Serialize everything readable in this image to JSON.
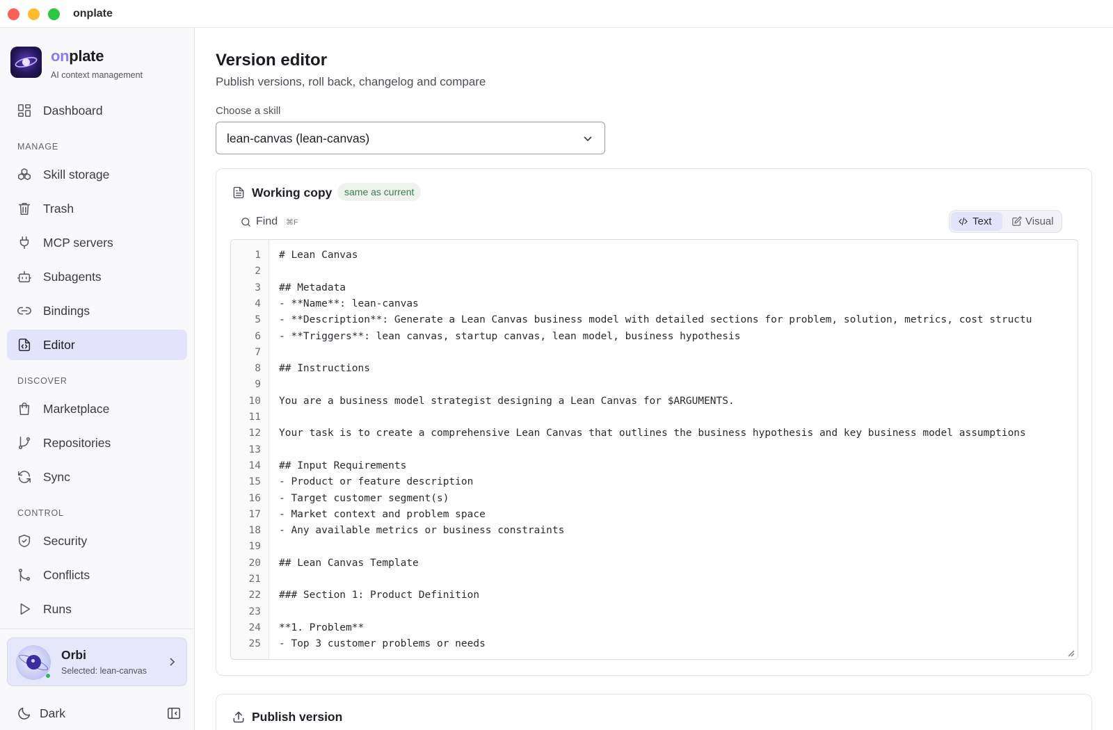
{
  "window": {
    "title": "onplate"
  },
  "brand": {
    "name_accent": "on",
    "name_rest": "plate",
    "subtitle": "AI context management"
  },
  "nav": {
    "dashboard": "Dashboard",
    "manage_label": "MANAGE",
    "skill_storage": "Skill storage",
    "trash": "Trash",
    "mcp_servers": "MCP servers",
    "subagents": "Subagents",
    "bindings": "Bindings",
    "editor": "Editor",
    "discover_label": "DISCOVER",
    "marketplace": "Marketplace",
    "repositories": "Repositories",
    "sync": "Sync",
    "control_label": "CONTROL",
    "security": "Security",
    "conflicts": "Conflicts",
    "runs": "Runs",
    "active_item": "Editor"
  },
  "assistant": {
    "name": "Orbi",
    "status": "Selected: lean-canvas"
  },
  "theme": {
    "label": "Dark"
  },
  "page": {
    "title": "Version editor",
    "subtitle": "Publish versions, roll back, changelog and compare",
    "choose_label": "Choose a skill",
    "selected_skill": "lean-canvas (lean-canvas)"
  },
  "working_copy": {
    "title": "Working copy",
    "badge": "same as current",
    "find_label": "Find",
    "find_shortcut": "⌘F",
    "mode_text": "Text",
    "mode_visual": "Visual",
    "active_mode": "Text"
  },
  "code_lines": [
    "# Lean Canvas",
    "",
    "## Metadata",
    "- **Name**: lean-canvas",
    "- **Description**: Generate a Lean Canvas business model with detailed sections for problem, solution, metrics, cost structu",
    "- **Triggers**: lean canvas, startup canvas, lean model, business hypothesis",
    "",
    "## Instructions",
    "",
    "You are a business model strategist designing a Lean Canvas for $ARGUMENTS.",
    "",
    "Your task is to create a comprehensive Lean Canvas that outlines the business hypothesis and key business model assumptions",
    "",
    "## Input Requirements",
    "- Product or feature description",
    "- Target customer segment(s)",
    "- Market context and problem space",
    "- Any available metrics or business constraints",
    "",
    "## Lean Canvas Template",
    "",
    "### Section 1: Product Definition",
    "",
    "**1. Problem**",
    "- Top 3 customer problems or needs"
  ],
  "publish": {
    "title": "Publish version"
  },
  "colors": {
    "accent": "#8a7cf0",
    "active_nav_bg": "#e3e4fb",
    "badge_text": "#3d7a4f",
    "badge_bg": "#eef3ee"
  }
}
